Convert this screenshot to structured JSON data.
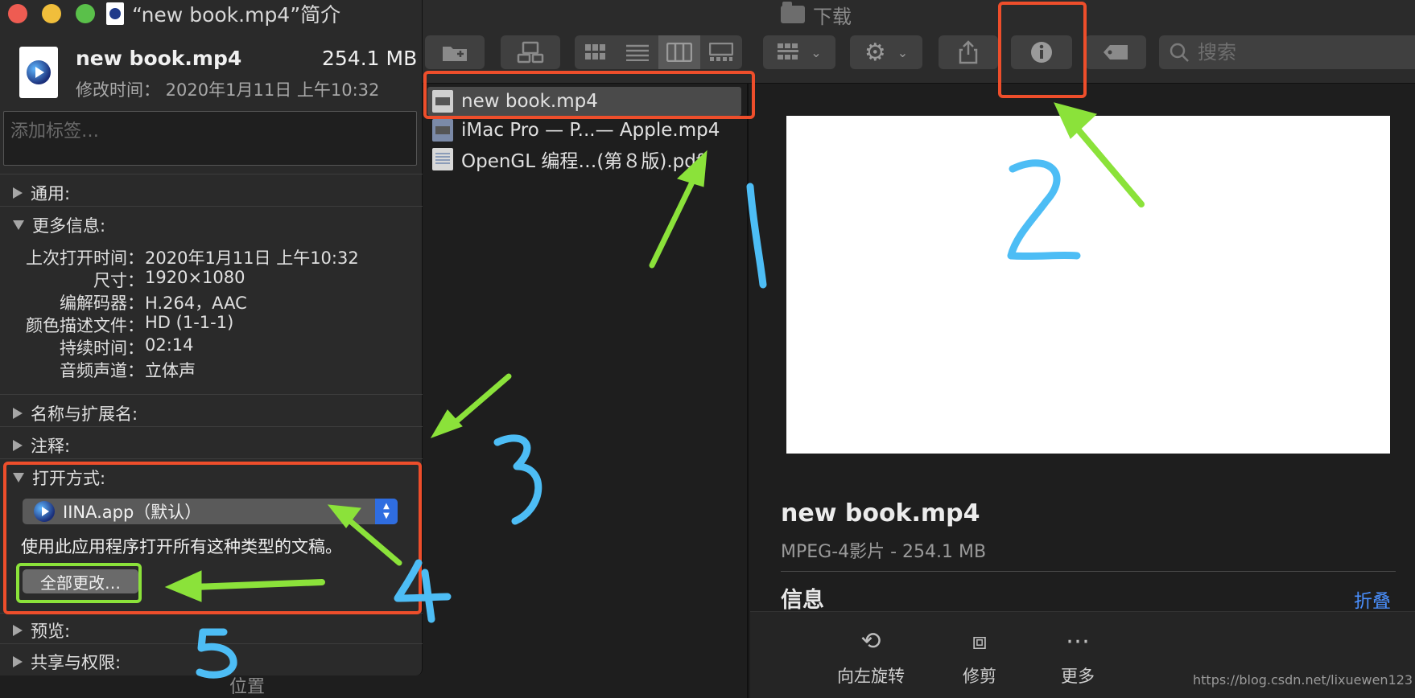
{
  "finder": {
    "title": "下载",
    "search_placeholder": "搜索",
    "files": [
      {
        "name": "new book.mp4",
        "kind": "video",
        "selected": true
      },
      {
        "name": "iMac Pro — P...— Apple.mp4",
        "kind": "video",
        "selected": false
      },
      {
        "name": "OpenGL 编程…(第８版).pdf",
        "kind": "pdf",
        "selected": false
      }
    ],
    "sidebar_location": "位置",
    "preview": {
      "file_name": "new book.mp4",
      "kind_line": "MPEG-4影片 - 254.1 MB",
      "info_heading": "信息",
      "collapse_label": "折叠",
      "actions": [
        {
          "label": "向左旋转",
          "icon": "rotate-left-icon"
        },
        {
          "label": "修剪",
          "icon": "trim-icon"
        },
        {
          "label": "更多",
          "icon": "more-icon"
        }
      ]
    },
    "watermark": "https://blog.csdn.net/lixuewen123"
  },
  "info_panel": {
    "window_title": "“new book.mp4”简介",
    "file_name": "new book.mp4",
    "file_size": "254.1 MB",
    "modified": "修改时间： 2020年1月11日 上午10:32",
    "tag_placeholder": "添加标签…",
    "sections": {
      "general": "通用:",
      "more_info": "更多信息:",
      "name_ext": "名称与扩展名:",
      "comments": "注释:",
      "open_with": "打开方式:",
      "preview": "预览:",
      "sharing": "共享与权限:"
    },
    "more_info_rows": [
      {
        "label": "上次打开时间：",
        "value": "2020年1月11日 上午10:32"
      },
      {
        "label": "尺寸：",
        "value": "1920×1080"
      },
      {
        "label": "编解码器：",
        "value": "H.264，AAC"
      },
      {
        "label": "颜色描述文件：",
        "value": "HD (1-1-1)"
      },
      {
        "label": "持续时间：",
        "value": "02:14"
      },
      {
        "label": "音频声道：",
        "value": "立体声"
      }
    ],
    "open_with_app": "IINA.app（默认）",
    "open_with_hint": "使用此应用程序打开所有这种类型的文稿。",
    "change_all_label": "全部更改…"
  },
  "colors": {
    "annotation_box": "#ee4e2b",
    "annotation_arrow": "#8be23a",
    "annotation_number": "#4dbdf5",
    "selection_blue": "#2f6de0",
    "link_blue": "#4a90ff"
  }
}
